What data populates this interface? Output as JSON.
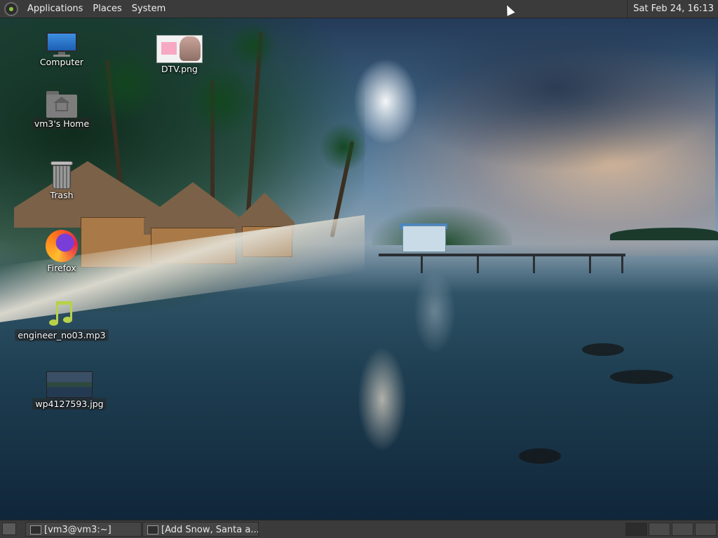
{
  "top_panel": {
    "menus": [
      "Applications",
      "Places",
      "System"
    ],
    "clock": "Sat Feb 24, 16:13"
  },
  "desktop_icons": {
    "computer": "Computer",
    "home": "vm3's Home",
    "trash": "Trash",
    "firefox": "Firefox",
    "mp3": "engineer_no03.mp3",
    "jpg": "wp4127593.jpg",
    "png": "DTV.png"
  },
  "taskbar": {
    "tasks": [
      "[vm3@vm3:~]",
      "[Add Snow, Santa a..."
    ]
  }
}
